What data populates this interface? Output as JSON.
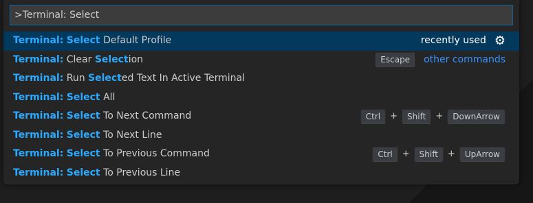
{
  "input": {
    "value": ">Terminal: Select"
  },
  "items": [
    {
      "prefix": "Terminal:",
      "hl": "Select",
      "suffix": " Default Profile",
      "right": {
        "text": "recently used",
        "icon": "gear-icon"
      }
    },
    {
      "prefix": "Terminal:",
      "pre": " Clear ",
      "hl": "Select",
      "suffix": "ion",
      "keys": [
        "Escape"
      ],
      "link": "other commands"
    },
    {
      "prefix": "Terminal:",
      "pre": " Run ",
      "hl": "Select",
      "suffix": "ed Text In Active Terminal"
    },
    {
      "prefix": "Terminal:",
      "hl": "Select",
      "suffix": " All"
    },
    {
      "prefix": "Terminal:",
      "hl": "Select",
      "suffix": " To Next Command",
      "keys": [
        "Ctrl",
        "Shift",
        "DownArrow"
      ]
    },
    {
      "prefix": "Terminal:",
      "hl": "Select",
      "suffix": " To Next Line"
    },
    {
      "prefix": "Terminal:",
      "hl": "Select",
      "suffix": " To Previous Command",
      "keys": [
        "Ctrl",
        "Shift",
        "UpArrow"
      ]
    },
    {
      "prefix": "Terminal:",
      "hl": "Select",
      "suffix": " To Previous Line"
    }
  ],
  "plus": "+",
  "colors": {
    "highlight": "#2aaaff",
    "selected_row": "#04395e",
    "link": "#3794ff",
    "input_border": "#0e639c"
  }
}
